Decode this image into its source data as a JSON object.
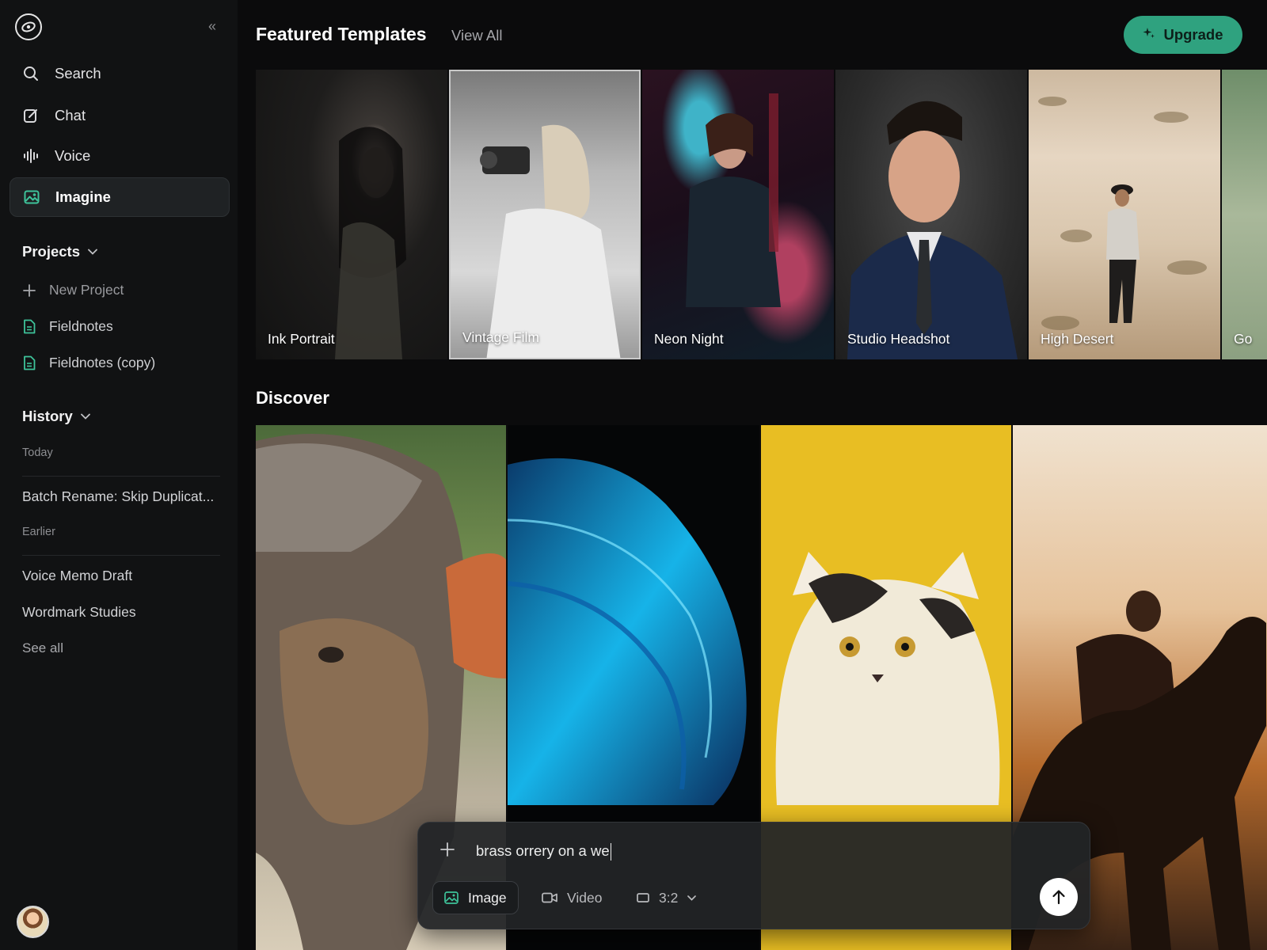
{
  "sidebar": {
    "nav": [
      {
        "label": "Search",
        "icon": "search-icon"
      },
      {
        "label": "Chat",
        "icon": "edit-icon"
      },
      {
        "label": "Voice",
        "icon": "waveform-icon"
      },
      {
        "label": "Imagine",
        "icon": "image-icon",
        "active": true
      }
    ],
    "projects": {
      "title": "Projects",
      "items": [
        {
          "label": "New Project",
          "icon": "plus-icon"
        },
        {
          "label": "Fieldnotes",
          "icon": "document-icon"
        },
        {
          "label": "Fieldnotes (copy)",
          "icon": "document-icon"
        }
      ]
    },
    "history": {
      "title": "History",
      "groups": [
        {
          "label": "Today",
          "items": [
            "Batch Rename: Skip Duplicat..."
          ]
        },
        {
          "label": "Earlier",
          "items": [
            "Voice Memo Draft",
            "Wordmark Studies"
          ]
        }
      ],
      "see_all": "See all"
    }
  },
  "header": {
    "title": "Featured Templates",
    "view_all": "View All",
    "upgrade": "Upgrade"
  },
  "templates": [
    {
      "label": "Ink Portrait"
    },
    {
      "label": "Vintage Film"
    },
    {
      "label": "Neon Night"
    },
    {
      "label": "Studio Headshot"
    },
    {
      "label": "High Desert"
    },
    {
      "label": "Go"
    }
  ],
  "discover": {
    "title": "Discover"
  },
  "prompt": {
    "text": "brass orrery on a we",
    "modes": [
      "Image",
      "Video"
    ],
    "aspect": "3:2"
  },
  "colors": {
    "accent": "#2fa27f",
    "sidebar_bg": "#111213",
    "main_bg": "#0b0b0c"
  }
}
